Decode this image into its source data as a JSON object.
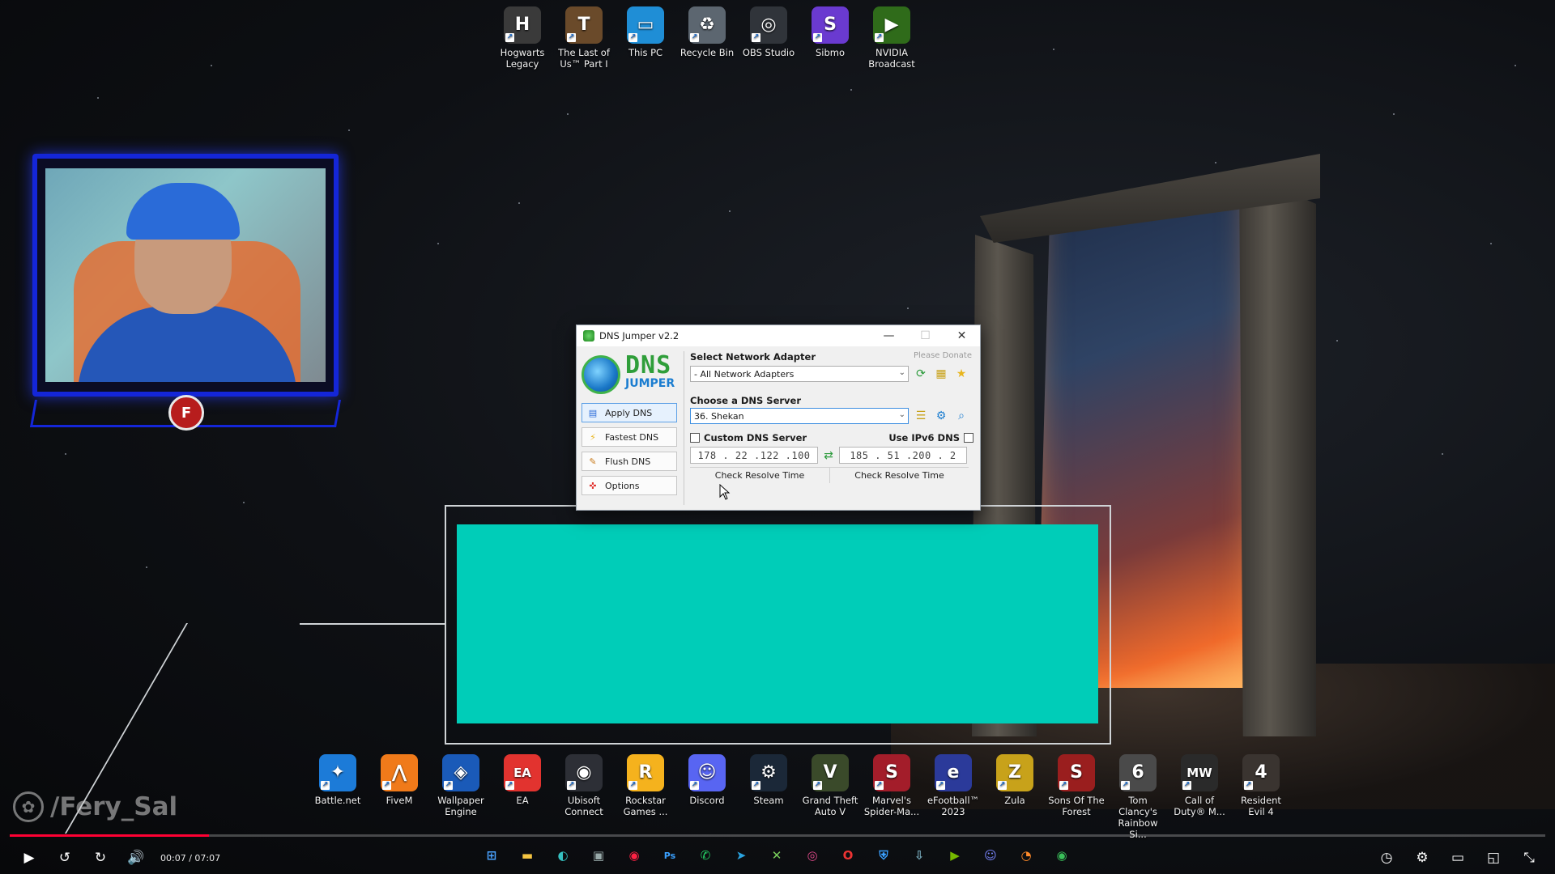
{
  "desktop_top_icons": [
    {
      "label": "Hogwarts Legacy",
      "icon": "hogwarts-icon",
      "color": "#3a3a3a",
      "glyph": "H"
    },
    {
      "label": "The Last of Us™ Part I",
      "icon": "tlou-icon",
      "color": "#6a4a2a",
      "glyph": "T"
    },
    {
      "label": "This PC",
      "icon": "monitor-icon",
      "color": "#1f8ed6",
      "glyph": "▭"
    },
    {
      "label": "Recycle Bin",
      "icon": "recycle-bin-icon",
      "color": "#5c6670",
      "glyph": "♻"
    },
    {
      "label": "OBS Studio",
      "icon": "obs-icon",
      "color": "#30343a",
      "glyph": "◎"
    },
    {
      "label": "Sibmo",
      "icon": "sibmo-icon",
      "color": "#6a3ad0",
      "glyph": "S"
    },
    {
      "label": "NVIDIA Broadcast",
      "icon": "nvidia-icon",
      "color": "#2f6b1a",
      "glyph": "▶"
    }
  ],
  "desktop_bottom_icons": [
    {
      "label": "Battle.net",
      "icon": "battlenet-icon",
      "color": "#1c7bd8",
      "glyph": "✦"
    },
    {
      "label": "FiveM",
      "icon": "fivem-icon",
      "color": "#f07a1a",
      "glyph": "⋀"
    },
    {
      "label": "Wallpaper Engine",
      "icon": "wallpaper-engine-icon",
      "color": "#1a5ab8",
      "glyph": "◈"
    },
    {
      "label": "EA",
      "icon": "ea-icon",
      "color": "#e2332f",
      "glyph": "EA"
    },
    {
      "label": "Ubisoft Connect",
      "icon": "ubisoft-icon",
      "color": "#2d2f36",
      "glyph": "◉"
    },
    {
      "label": "Rockstar Games ...",
      "icon": "rockstar-icon",
      "color": "#f5b21d",
      "glyph": "R"
    },
    {
      "label": "Discord",
      "icon": "discord-icon",
      "color": "#5865f2",
      "glyph": "☺"
    },
    {
      "label": "Steam",
      "icon": "steam-icon",
      "color": "#1b2838",
      "glyph": "⚙"
    },
    {
      "label": "Grand Theft Auto V",
      "icon": "gta-icon",
      "color": "#3a4a2a",
      "glyph": "V"
    },
    {
      "label": "Marvel's Spider-Ma...",
      "icon": "spiderman-icon",
      "color": "#a31d2a",
      "glyph": "S"
    },
    {
      "label": "eFootball™ 2023",
      "icon": "efootball-icon",
      "color": "#2b3a9a",
      "glyph": "e"
    },
    {
      "label": "Zula",
      "icon": "zula-icon",
      "color": "#c8a21a",
      "glyph": "Z"
    },
    {
      "label": "Sons Of The Forest",
      "icon": "sons-forest-icon",
      "color": "#9a1e1e",
      "glyph": "S"
    },
    {
      "label": "Tom Clancy's Rainbow Si...",
      "icon": "rainbow-six-icon",
      "color": "#4a4a4a",
      "glyph": "6"
    },
    {
      "label": "Call of Duty® M...",
      "icon": "cod-icon",
      "color": "#2a2a2a",
      "glyph": "MW"
    },
    {
      "label": "Resident Evil 4",
      "icon": "re4-icon",
      "color": "#3a3430",
      "glyph": "4"
    }
  ],
  "dns_window": {
    "title": "DNS Jumper v2.2",
    "logo_top": "DNS",
    "logo_bottom": "JUMPER",
    "menu": [
      {
        "label": "Apply DNS",
        "icon": "apply-icon",
        "active": true
      },
      {
        "label": "Fastest DNS",
        "icon": "lightning-icon",
        "active": false
      },
      {
        "label": "Flush DNS",
        "icon": "broom-icon",
        "active": false
      },
      {
        "label": "Options",
        "icon": "options-icon",
        "active": false
      }
    ],
    "adapter_label": "Select Network Adapter",
    "donate": "Please Donate",
    "adapter_value": "- All Network Adapters",
    "server_label": "Choose a DNS Server",
    "server_value": "36. Shekan",
    "custom_label": "Custom DNS Server",
    "ipv6_label": "Use IPv6 DNS",
    "primary_ip": "178 . 22 .122 .100",
    "secondary_ip": "185 . 51 .200 . 2",
    "resolve_1": "Check Resolve Time",
    "resolve_2": "Check Resolve Time"
  },
  "watermark": "/Fery_Sal",
  "player": {
    "time": "00:07 / 07:07",
    "progress": 0.13
  },
  "colors": {
    "teal": "#00cdb8",
    "cam_border": "#1426d8",
    "progress": "#ff0033"
  }
}
